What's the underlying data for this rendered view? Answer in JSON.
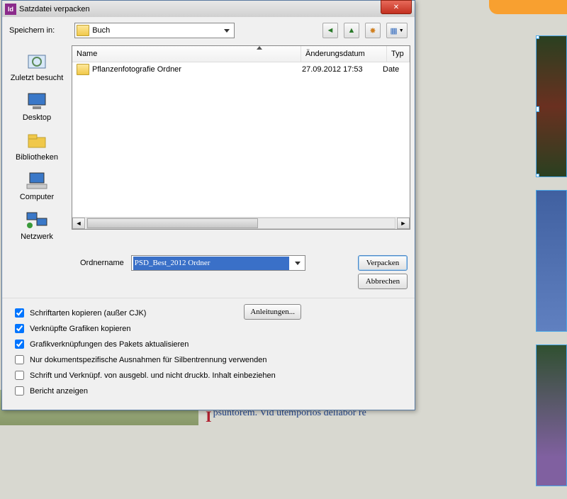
{
  "title": "Satzdatei verpacken",
  "save_in_label": "Speichern in:",
  "location_combo": "Buch",
  "places": [
    {
      "label": "Zuletzt besucht"
    },
    {
      "label": "Desktop"
    },
    {
      "label": "Bibliotheken"
    },
    {
      "label": "Computer"
    },
    {
      "label": "Netzwerk"
    }
  ],
  "cols": {
    "name": "Name",
    "mod": "Änderungsdatum",
    "type": "Typ"
  },
  "rows": [
    {
      "name": "Pflanzenfotografie Ordner",
      "mod": "27.09.2012 17:53",
      "type": "Date"
    }
  ],
  "foldername_label": "Ordnername",
  "foldername_value": "PSD_Best_2012 Ordner",
  "btn_pack": "Verpacken",
  "btn_cancel": "Abbrechen",
  "btn_instr": "Anleitungen...",
  "opts": [
    {
      "label": "Schriftarten kopieren (außer CJK)",
      "checked": true
    },
    {
      "label": "Verknüpfte Grafiken kopieren",
      "checked": true
    },
    {
      "label": "Grafikverknüpfungen des Pakets aktualisieren",
      "checked": true
    },
    {
      "label": "Nur dokumentspezifische Ausnahmen für Silbentrennung verwenden",
      "checked": false
    },
    {
      "label": "Schrift und Verknüpf. von ausgebl. und nicht druckb. Inhalt einbeziehen",
      "checked": false
    },
    {
      "label": "Bericht anzeigen",
      "checked": false
    }
  ],
  "under_text": "psuntorem. Vid utemporios dellabor re",
  "under_initial": "I"
}
